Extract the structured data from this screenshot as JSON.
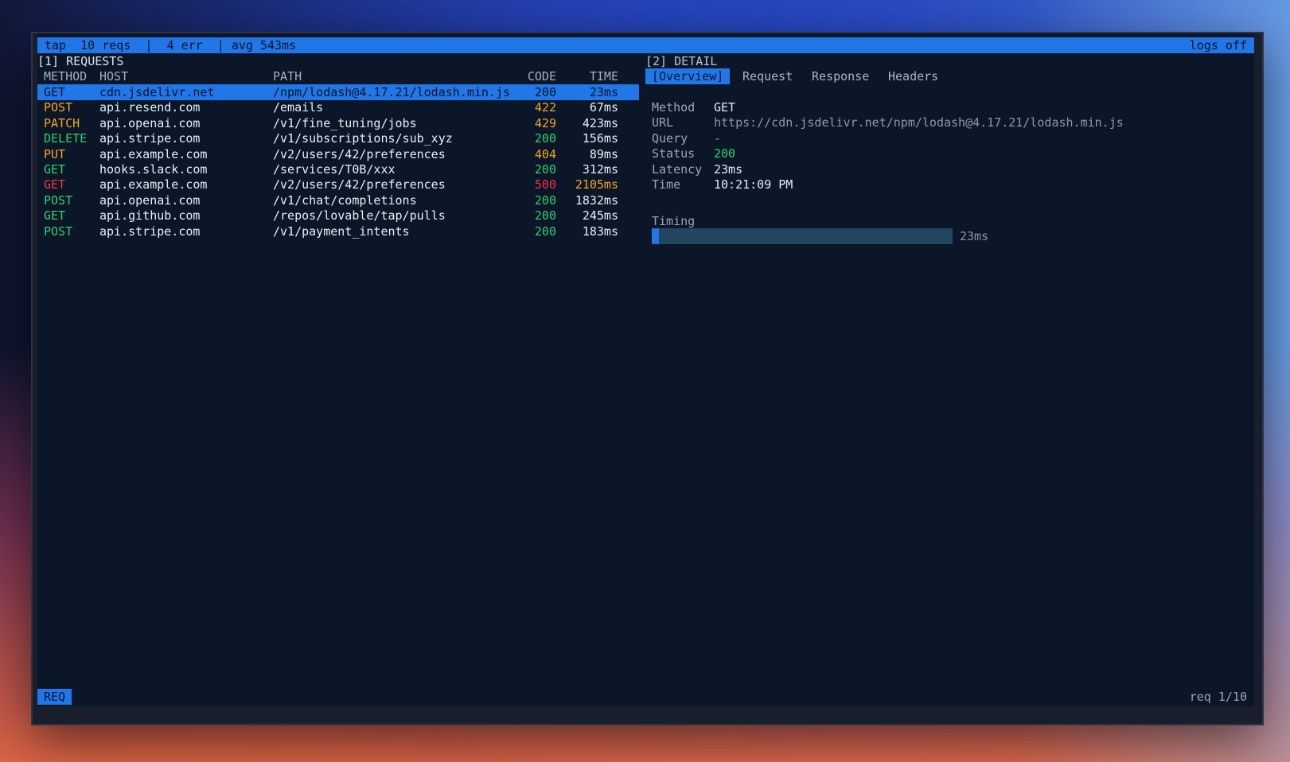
{
  "colors": {
    "accent": "#2277e8",
    "green": "#33d06a",
    "orange": "#f5a623",
    "red": "#f2393b",
    "background": "#0b1628"
  },
  "topbar": {
    "app": "tap",
    "reqs": "10 reqs",
    "sep1": "|",
    "err": "4 err",
    "sep2": "|",
    "avg": "avg 543ms",
    "logs": "logs off"
  },
  "requests_panel": {
    "title": "[1] REQUESTS",
    "columns": {
      "method": "METHOD",
      "host": "HOST",
      "path": "PATH",
      "code": "CODE",
      "time": "TIME"
    },
    "rows": [
      {
        "method": "GET",
        "host": "cdn.jsdelivr.net",
        "path": "/npm/lodash@4.17.21/lodash.min.js",
        "code": "200",
        "time": "23ms",
        "method_color": "green",
        "code_color": "green",
        "time_color": "white",
        "selected": true
      },
      {
        "method": "POST",
        "host": "api.resend.com",
        "path": "/emails",
        "code": "422",
        "time": "67ms",
        "method_color": "orange",
        "code_color": "orange",
        "time_color": "white",
        "selected": false
      },
      {
        "method": "PATCH",
        "host": "api.openai.com",
        "path": "/v1/fine_tuning/jobs",
        "code": "429",
        "time": "423ms",
        "method_color": "orange",
        "code_color": "orange",
        "time_color": "white",
        "selected": false
      },
      {
        "method": "DELETE",
        "host": "api.stripe.com",
        "path": "/v1/subscriptions/sub_xyz",
        "code": "200",
        "time": "156ms",
        "method_color": "green",
        "code_color": "green",
        "time_color": "white",
        "selected": false
      },
      {
        "method": "PUT",
        "host": "api.example.com",
        "path": "/v2/users/42/preferences",
        "code": "404",
        "time": "89ms",
        "method_color": "orange",
        "code_color": "orange",
        "time_color": "white",
        "selected": false
      },
      {
        "method": "GET",
        "host": "hooks.slack.com",
        "path": "/services/T0B/xxx",
        "code": "200",
        "time": "312ms",
        "method_color": "green",
        "code_color": "green",
        "time_color": "white",
        "selected": false
      },
      {
        "method": "GET",
        "host": "api.example.com",
        "path": "/v2/users/42/preferences",
        "code": "500",
        "time": "2105ms",
        "method_color": "red",
        "code_color": "red",
        "time_color": "orange",
        "selected": false
      },
      {
        "method": "POST",
        "host": "api.openai.com",
        "path": "/v1/chat/completions",
        "code": "200",
        "time": "1832ms",
        "method_color": "green",
        "code_color": "green",
        "time_color": "white",
        "selected": false
      },
      {
        "method": "GET",
        "host": "api.github.com",
        "path": "/repos/lovable/tap/pulls",
        "code": "200",
        "time": "245ms",
        "method_color": "green",
        "code_color": "green",
        "time_color": "white",
        "selected": false
      },
      {
        "method": "POST",
        "host": "api.stripe.com",
        "path": "/v1/payment_intents",
        "code": "200",
        "time": "183ms",
        "method_color": "green",
        "code_color": "green",
        "time_color": "white",
        "selected": false
      }
    ]
  },
  "detail_panel": {
    "title": "[2] DETAIL",
    "tabs": [
      "[Overview]",
      "Request",
      "Response",
      "Headers"
    ],
    "active_tab": 0,
    "fields": [
      {
        "label": "Method",
        "value": "GET",
        "value_color": "white"
      },
      {
        "label": "URL",
        "value": "https://cdn.jsdelivr.net/npm/lodash@4.17.21/lodash.min.js",
        "value_color": "gray"
      },
      {
        "label": "Query",
        "value": "-",
        "value_color": "gray"
      },
      {
        "label": "Status",
        "value": "200",
        "value_color": "green"
      },
      {
        "label": "Latency",
        "value": "23ms",
        "value_color": "white"
      },
      {
        "label": "Time",
        "value": "10:21:09 PM",
        "value_color": "white"
      }
    ],
    "timing": {
      "label": "Timing",
      "fill_fraction": 0.025,
      "value": "23ms"
    }
  },
  "statusbar": {
    "mode": "REQ",
    "counter": "req 1/10"
  }
}
